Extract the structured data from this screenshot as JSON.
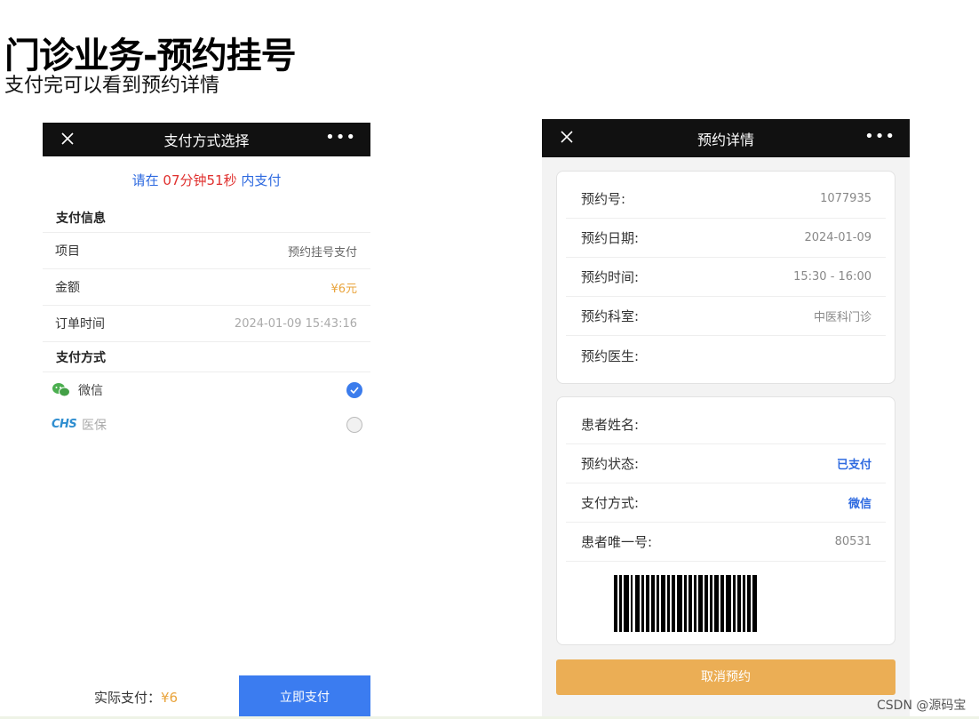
{
  "slide": {
    "title": "门诊业务-预约挂号",
    "subtitle": "支付完可以看到预约详情"
  },
  "left_phone": {
    "nav_title": "支付方式选择",
    "countdown": {
      "prefix": "请在",
      "time": "07分钟51秒",
      "suffix": "内支付"
    },
    "pay_info_header": "支付信息",
    "rows": [
      {
        "label": "项目",
        "value": "预约挂号支付"
      },
      {
        "label": "金额",
        "value": "¥6元"
      },
      {
        "label": "订单时间",
        "value": "2024-01-09 15:43:16"
      }
    ],
    "pay_method_header": "支付方式",
    "methods": [
      {
        "label": "微信",
        "selected": true,
        "icon": "wechat-icon"
      },
      {
        "label": "医保",
        "logo_text": "CHS",
        "selected": false,
        "icon": "chs-logo"
      }
    ],
    "actual_label": "实际支付：",
    "actual_amount": "¥6",
    "pay_button": "立即支付"
  },
  "right_phone": {
    "nav_title": "预约详情",
    "card1": [
      {
        "label": "预约号:",
        "value": "1077935"
      },
      {
        "label": "预约日期:",
        "value": "2024-01-09"
      },
      {
        "label": "预约时间:",
        "value": "15:30 - 16:00"
      },
      {
        "label": "预约科室:",
        "value": "中医科门诊"
      },
      {
        "label": "预约医生:",
        "value": ""
      }
    ],
    "card2": [
      {
        "label": "患者姓名:",
        "value": ""
      },
      {
        "label": "预约状态:",
        "value": "已支付"
      },
      {
        "label": "支付方式:",
        "value": "微信"
      },
      {
        "label": "患者唯一号:",
        "value": "80531"
      }
    ],
    "cancel_button": "取消预约"
  },
  "watermark": "CSDN @源码宝",
  "colors": {
    "accent_blue": "#3b7cf0",
    "price_orange": "#e9a43c",
    "cancel_orange": "#ebae55",
    "countdown_red": "#e0302e"
  }
}
